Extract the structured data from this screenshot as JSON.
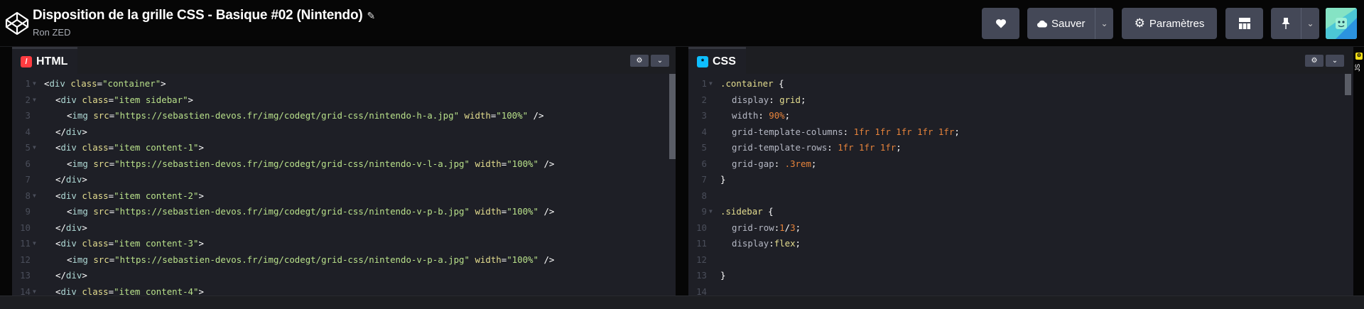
{
  "header": {
    "title": "Disposition de la grille CSS - Basique #02 (Nintendo)",
    "author": "Ron ZED",
    "buttons": {
      "like": "heart-icon",
      "save_label": "Sauver",
      "settings_label": "Paramètres",
      "layout": "layout-icon",
      "pin": "pin-icon"
    }
  },
  "html_panel": {
    "tab_label": "HTML",
    "accent": "#ff3c41",
    "lines": [
      {
        "n": "1",
        "fold": true,
        "indent": 0,
        "parts": [
          [
            "punc",
            "<"
          ],
          [
            "tag",
            "div"
          ],
          [
            "",
            ""
          ],
          [
            "attr",
            " class"
          ],
          [
            "punc",
            "="
          ],
          [
            "str",
            "\"container\""
          ],
          [
            "punc",
            ">"
          ]
        ]
      },
      {
        "n": "2",
        "fold": true,
        "indent": 1,
        "parts": [
          [
            "punc",
            "<"
          ],
          [
            "tag",
            "div"
          ],
          [
            "attr",
            " class"
          ],
          [
            "punc",
            "="
          ],
          [
            "str",
            "\"item sidebar\""
          ],
          [
            "punc",
            ">"
          ]
        ]
      },
      {
        "n": "3",
        "fold": false,
        "indent": 2,
        "parts": [
          [
            "punc",
            "<"
          ],
          [
            "tag",
            "img"
          ],
          [
            "attr",
            " src"
          ],
          [
            "punc",
            "="
          ],
          [
            "str",
            "\"https://sebastien-devos.fr/img/codegt/grid-css/nintendo-h-a.jpg\""
          ],
          [
            "attr",
            " width"
          ],
          [
            "punc",
            "="
          ],
          [
            "str",
            "\"100%\""
          ],
          [
            "punc",
            " />"
          ]
        ]
      },
      {
        "n": "4",
        "fold": false,
        "indent": 1,
        "parts": [
          [
            "punc",
            "</"
          ],
          [
            "tag",
            "div"
          ],
          [
            "punc",
            ">"
          ]
        ]
      },
      {
        "n": "5",
        "fold": true,
        "indent": 1,
        "parts": [
          [
            "punc",
            "<"
          ],
          [
            "tag",
            "div"
          ],
          [
            "attr",
            " class"
          ],
          [
            "punc",
            "="
          ],
          [
            "str",
            "\"item content-1\""
          ],
          [
            "punc",
            ">"
          ]
        ]
      },
      {
        "n": "6",
        "fold": false,
        "indent": 2,
        "parts": [
          [
            "punc",
            "<"
          ],
          [
            "tag",
            "img"
          ],
          [
            "attr",
            " src"
          ],
          [
            "punc",
            "="
          ],
          [
            "str",
            "\"https://sebastien-devos.fr/img/codegt/grid-css/nintendo-v-l-a.jpg\""
          ],
          [
            "attr",
            " width"
          ],
          [
            "punc",
            "="
          ],
          [
            "str",
            "\"100%\""
          ],
          [
            "punc",
            " />"
          ]
        ]
      },
      {
        "n": "7",
        "fold": false,
        "indent": 1,
        "parts": [
          [
            "punc",
            "</"
          ],
          [
            "tag",
            "div"
          ],
          [
            "punc",
            ">"
          ]
        ]
      },
      {
        "n": "8",
        "fold": true,
        "indent": 1,
        "parts": [
          [
            "punc",
            "<"
          ],
          [
            "tag",
            "div"
          ],
          [
            "attr",
            " class"
          ],
          [
            "punc",
            "="
          ],
          [
            "str",
            "\"item content-2\""
          ],
          [
            "punc",
            ">"
          ]
        ]
      },
      {
        "n": "9",
        "fold": false,
        "indent": 2,
        "parts": [
          [
            "punc",
            "<"
          ],
          [
            "tag",
            "img"
          ],
          [
            "attr",
            " src"
          ],
          [
            "punc",
            "="
          ],
          [
            "str",
            "\"https://sebastien-devos.fr/img/codegt/grid-css/nintendo-v-p-b.jpg\""
          ],
          [
            "attr",
            " width"
          ],
          [
            "punc",
            "="
          ],
          [
            "str",
            "\"100%\""
          ],
          [
            "punc",
            " />"
          ]
        ]
      },
      {
        "n": "10",
        "fold": false,
        "indent": 1,
        "parts": [
          [
            "punc",
            "</"
          ],
          [
            "tag",
            "div"
          ],
          [
            "punc",
            ">"
          ]
        ]
      },
      {
        "n": "11",
        "fold": true,
        "indent": 1,
        "parts": [
          [
            "punc",
            "<"
          ],
          [
            "tag",
            "div"
          ],
          [
            "attr",
            " class"
          ],
          [
            "punc",
            "="
          ],
          [
            "str",
            "\"item content-3\""
          ],
          [
            "punc",
            ">"
          ]
        ]
      },
      {
        "n": "12",
        "fold": false,
        "indent": 2,
        "parts": [
          [
            "punc",
            "<"
          ],
          [
            "tag",
            "img"
          ],
          [
            "attr",
            " src"
          ],
          [
            "punc",
            "="
          ],
          [
            "str",
            "\"https://sebastien-devos.fr/img/codegt/grid-css/nintendo-v-p-a.jpg\""
          ],
          [
            "attr",
            " width"
          ],
          [
            "punc",
            "="
          ],
          [
            "str",
            "\"100%\""
          ],
          [
            "punc",
            " />"
          ]
        ]
      },
      {
        "n": "13",
        "fold": false,
        "indent": 1,
        "parts": [
          [
            "punc",
            "</"
          ],
          [
            "tag",
            "div"
          ],
          [
            "punc",
            ">"
          ]
        ]
      },
      {
        "n": "14",
        "fold": true,
        "indent": 1,
        "parts": [
          [
            "punc",
            "<"
          ],
          [
            "tag",
            "div"
          ],
          [
            "attr",
            " class"
          ],
          [
            "punc",
            "="
          ],
          [
            "str",
            "\"item content-4\""
          ],
          [
            "punc",
            ">"
          ]
        ]
      }
    ]
  },
  "css_panel": {
    "tab_label": "CSS",
    "accent": "#0ebeff",
    "lines": [
      {
        "n": "1",
        "fold": true,
        "indent": 0,
        "parts": [
          [
            "sel",
            ".container"
          ],
          [
            "punc",
            " {"
          ]
        ]
      },
      {
        "n": "2",
        "fold": false,
        "indent": 1,
        "parts": [
          [
            "prop",
            "display"
          ],
          [
            "punc",
            ": "
          ],
          [
            "kw",
            "grid"
          ],
          [
            "punc",
            ";"
          ]
        ]
      },
      {
        "n": "3",
        "fold": false,
        "indent": 1,
        "parts": [
          [
            "prop",
            "width"
          ],
          [
            "punc",
            ": "
          ],
          [
            "val",
            "90%"
          ],
          [
            "punc",
            ";"
          ]
        ]
      },
      {
        "n": "4",
        "fold": false,
        "indent": 1,
        "parts": [
          [
            "prop",
            "grid-template-columns"
          ],
          [
            "punc",
            ": "
          ],
          [
            "val",
            "1fr 1fr 1fr 1fr 1fr"
          ],
          [
            "punc",
            ";"
          ]
        ]
      },
      {
        "n": "5",
        "fold": false,
        "indent": 1,
        "parts": [
          [
            "prop",
            "grid-template-rows"
          ],
          [
            "punc",
            ": "
          ],
          [
            "val",
            "1fr 1fr 1fr"
          ],
          [
            "punc",
            ";"
          ]
        ]
      },
      {
        "n": "6",
        "fold": false,
        "indent": 1,
        "parts": [
          [
            "prop",
            "grid-gap"
          ],
          [
            "punc",
            ": "
          ],
          [
            "val",
            ".3rem"
          ],
          [
            "punc",
            ";"
          ]
        ]
      },
      {
        "n": "7",
        "fold": false,
        "indent": 0,
        "parts": [
          [
            "punc",
            "}"
          ]
        ]
      },
      {
        "n": "8",
        "fold": false,
        "indent": 0,
        "parts": []
      },
      {
        "n": "9",
        "fold": true,
        "indent": 0,
        "parts": [
          [
            "sel",
            ".sidebar"
          ],
          [
            "punc",
            " {"
          ]
        ]
      },
      {
        "n": "10",
        "fold": false,
        "indent": 1,
        "parts": [
          [
            "prop",
            "grid-row"
          ],
          [
            "punc",
            ":"
          ],
          [
            "val",
            "1"
          ],
          [
            "punc",
            "/"
          ],
          [
            "val",
            "3"
          ],
          [
            "punc",
            ";"
          ]
        ]
      },
      {
        "n": "11",
        "fold": false,
        "indent": 1,
        "parts": [
          [
            "prop",
            "display"
          ],
          [
            "punc",
            ":"
          ],
          [
            "kw",
            "flex"
          ],
          [
            "punc",
            ";"
          ]
        ]
      },
      {
        "n": "12",
        "fold": false,
        "indent": 0,
        "parts": []
      },
      {
        "n": "13",
        "fold": false,
        "indent": 0,
        "parts": [
          [
            "punc",
            "}"
          ]
        ]
      },
      {
        "n": "14",
        "fold": false,
        "indent": 0,
        "parts": []
      }
    ]
  },
  "js_panel": {
    "label": "JS"
  }
}
